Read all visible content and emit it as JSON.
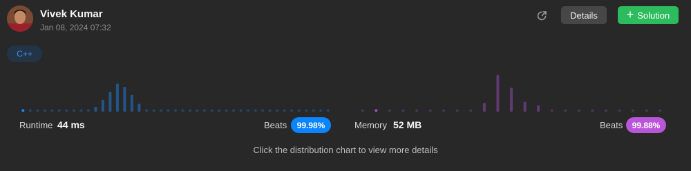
{
  "user": {
    "name": "Vivek Kumar",
    "date": "Jan 08, 2024 07:32"
  },
  "actions": {
    "share_icon": "share-icon",
    "details_label": "Details",
    "solution_label": "Solution",
    "solution_icon": "plus-icon"
  },
  "language": "C++",
  "runtime": {
    "label": "Runtime",
    "value": "44 ms",
    "beats_label": "Beats",
    "beats": "99.98%",
    "color": "#1a8cff",
    "badge_color": "#0a84ff",
    "distribution": [
      0.06,
      0.06,
      0.06,
      0.06,
      0.06,
      0.06,
      0.06,
      0.06,
      0.06,
      0.06,
      0.12,
      0.3,
      0.5,
      0.7,
      0.62,
      0.42,
      0.2,
      0.06,
      0.06,
      0.06,
      0.06,
      0.06,
      0.06,
      0.06,
      0.06,
      0.06,
      0.06,
      0.06,
      0.06,
      0.06,
      0.06,
      0.06,
      0.06,
      0.06,
      0.06,
      0.06,
      0.06,
      0.06,
      0.06,
      0.06,
      0.06,
      0.06,
      0.06
    ],
    "highlight_index": 0
  },
  "memory": {
    "label": "Memory",
    "value": "52 MB",
    "beats_label": "Beats",
    "beats": "99.88%",
    "color": "#a14fc8",
    "badge_color": "#b955d9",
    "distribution": [
      0.06,
      0.06,
      0.06,
      0.06,
      0.06,
      0.06,
      0.06,
      0.06,
      0.06,
      0.22,
      0.92,
      0.6,
      0.25,
      0.16,
      0.06,
      0.06,
      0.06,
      0.06,
      0.06,
      0.06,
      0.06,
      0.06,
      0.06
    ],
    "highlight_index": 1
  },
  "hint": "Click the distribution chart to view more details"
}
